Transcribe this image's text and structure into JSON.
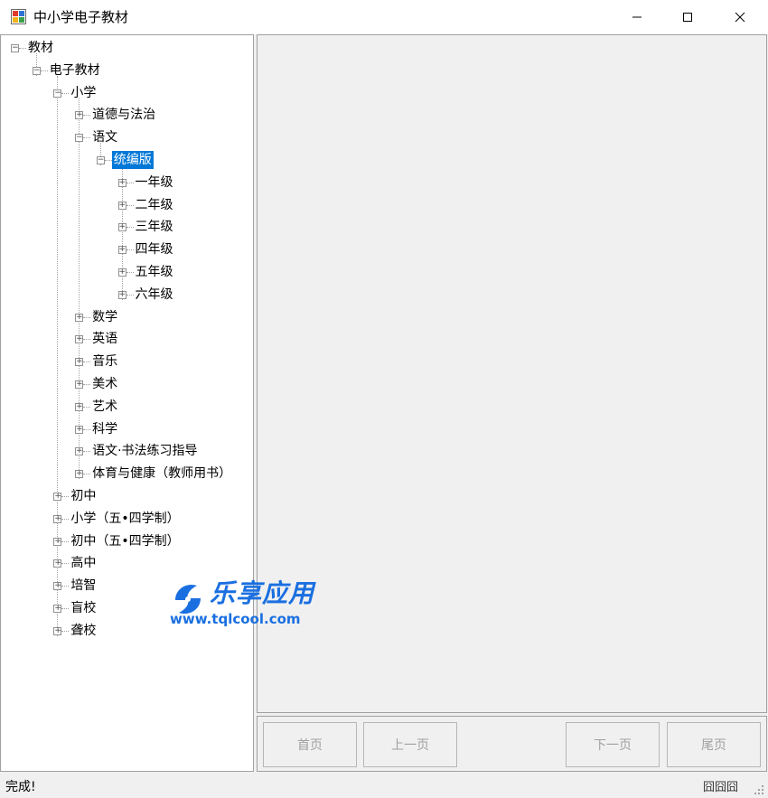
{
  "window": {
    "title": "中小学电子教材",
    "controls": {
      "minimize": "minimize",
      "maximize": "maximize",
      "close": "close"
    }
  },
  "tree": {
    "nodes": [
      {
        "label": "教材",
        "depth": 0,
        "toggle": "−"
      },
      {
        "label": "电子教材",
        "depth": 1,
        "toggle": "−"
      },
      {
        "label": "小学",
        "depth": 2,
        "toggle": "−"
      },
      {
        "label": "道德与法治",
        "depth": 3,
        "toggle": "+"
      },
      {
        "label": "语文",
        "depth": 3,
        "toggle": "−"
      },
      {
        "label": "统编版",
        "depth": 4,
        "toggle": "−",
        "selected": true
      },
      {
        "label": "一年级",
        "depth": 5,
        "toggle": "+"
      },
      {
        "label": "二年级",
        "depth": 5,
        "toggle": "+"
      },
      {
        "label": "三年级",
        "depth": 5,
        "toggle": "+"
      },
      {
        "label": "四年级",
        "depth": 5,
        "toggle": "+"
      },
      {
        "label": "五年级",
        "depth": 5,
        "toggle": "+"
      },
      {
        "label": "六年级",
        "depth": 5,
        "toggle": "+"
      },
      {
        "label": "数学",
        "depth": 3,
        "toggle": "+"
      },
      {
        "label": "英语",
        "depth": 3,
        "toggle": "+"
      },
      {
        "label": "音乐",
        "depth": 3,
        "toggle": "+"
      },
      {
        "label": "美术",
        "depth": 3,
        "toggle": "+"
      },
      {
        "label": "艺术",
        "depth": 3,
        "toggle": "+"
      },
      {
        "label": "科学",
        "depth": 3,
        "toggle": "+"
      },
      {
        "label": "语文·书法练习指导",
        "depth": 3,
        "toggle": "+"
      },
      {
        "label": "体育与健康（教师用书）",
        "depth": 3,
        "toggle": "+"
      },
      {
        "label": "初中",
        "depth": 2,
        "toggle": "+"
      },
      {
        "label": "小学（五•四学制）",
        "depth": 2,
        "toggle": "+"
      },
      {
        "label": "初中（五•四学制）",
        "depth": 2,
        "toggle": "+"
      },
      {
        "label": "高中",
        "depth": 2,
        "toggle": "+"
      },
      {
        "label": "培智",
        "depth": 2,
        "toggle": "+"
      },
      {
        "label": "盲校",
        "depth": 2,
        "toggle": "+"
      },
      {
        "label": "聋校",
        "depth": 2,
        "toggle": "+"
      }
    ]
  },
  "nav": {
    "first": "首页",
    "prev": "上一页",
    "next": "下一页",
    "last": "尾页"
  },
  "status": {
    "text": "完成!",
    "indicator": "囧囧囧"
  },
  "watermark": {
    "title": "乐享应用",
    "url": "www.tqlcool.com"
  },
  "colors": {
    "selection": "#0078d7",
    "watermark": "#1a6fe0"
  }
}
